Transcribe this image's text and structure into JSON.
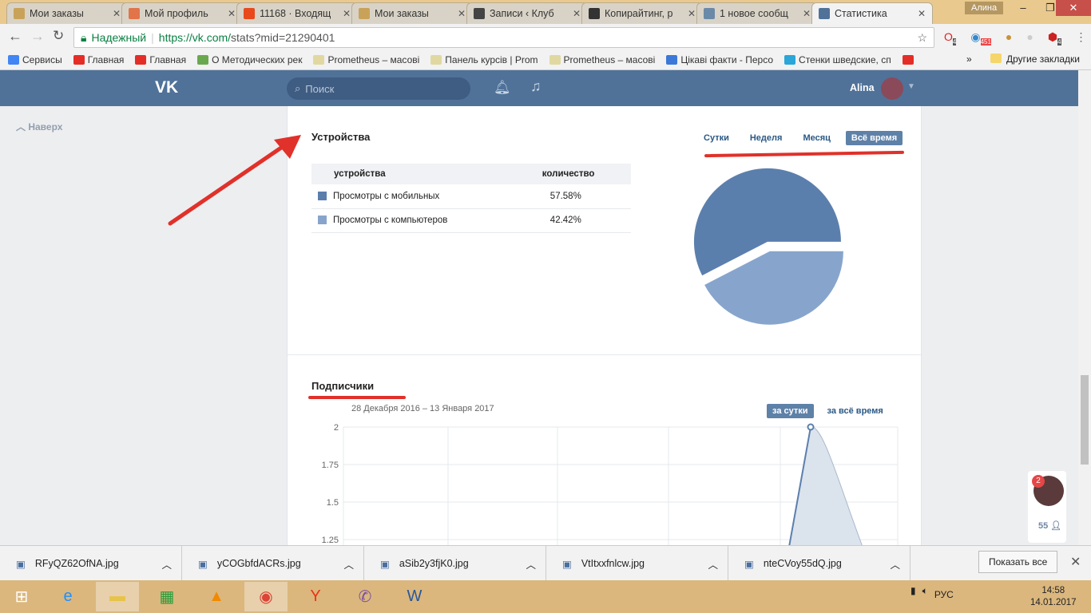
{
  "browser": {
    "tabs": [
      {
        "label": "Мои заказы",
        "icon": "box-icon",
        "color": "#c9a25a"
      },
      {
        "label": "Мой профиль",
        "icon": "olx-icon",
        "color": "#e2744a"
      },
      {
        "label": "11168 · Входящ",
        "icon": "mail-icon",
        "color": "#e84a1c"
      },
      {
        "label": "Мои заказы",
        "icon": "box-icon",
        "color": "#c9a25a"
      },
      {
        "label": "Записи ‹ Клуб",
        "icon": "s-icon",
        "color": "#444444"
      },
      {
        "label": "Копирайтинг, р",
        "icon": "a-icon",
        "color": "#333333"
      },
      {
        "label": "1 новое сообщ",
        "icon": "message-icon",
        "color": "#6b8aa8"
      },
      {
        "label": "Статистика",
        "icon": "vk-icon",
        "color": "#507299",
        "active": true
      }
    ],
    "user": "Алина",
    "security": "Надежный",
    "url_host": "https://vk.com/",
    "url_path": "stats?mid=21290401",
    "extension_badges": [
      "4",
      "451",
      "4"
    ],
    "bookmarks": [
      {
        "label": "Сервисы",
        "color": "#4285f4"
      },
      {
        "label": "Главная",
        "color": "#e52d27"
      },
      {
        "label": "Главная",
        "color": "#e52d27"
      },
      {
        "label": "О Методических рек",
        "color": "#6aa84f"
      },
      {
        "label": "Prometheus – масові",
        "color": "#e0d8a0"
      },
      {
        "label": "Панель курсів | Prom",
        "color": "#e0d8a0"
      },
      {
        "label": "Prometheus – масові",
        "color": "#e0d8a0"
      },
      {
        "label": "Цікаві факти - Персо",
        "color": "#3c78d8"
      },
      {
        "label": "Стенки шведские, сп",
        "color": "#2aa6d8"
      }
    ],
    "more": "»",
    "other_bookmarks": "Другие закладки"
  },
  "vk": {
    "search_placeholder": "Поиск",
    "user_name": "Alina",
    "back_to_top": "Наверх",
    "friends_count": "55",
    "chat_badge": "2"
  },
  "devices": {
    "title": "Устройства",
    "periods": [
      "Сутки",
      "Неделя",
      "Месяц",
      "Всё время"
    ],
    "active_period": "Всё время",
    "columns": [
      "устройства",
      "количество"
    ],
    "rows": [
      {
        "label": "Просмотры с мобильных",
        "value": "57.58%",
        "color": "#5b7fad"
      },
      {
        "label": "Просмотры с компьютеров",
        "value": "42.42%",
        "color": "#87a5cc"
      }
    ]
  },
  "subscribers": {
    "title": "Подписчики",
    "date_range": "28 Декабря 2016 – 13 Января 2017",
    "periods": [
      "за сутки",
      "за всё время"
    ],
    "active_period": "за сутки"
  },
  "chart_data": [
    {
      "type": "pie",
      "values": [
        57.58,
        42.42
      ],
      "labels": [
        "Просмотры с мобильных",
        "Просмотры с компьютеров"
      ],
      "colors": [
        "#5b7fad",
        "#87a5cc"
      ]
    },
    {
      "type": "area",
      "yticks": [
        "2",
        "1.75",
        "1.5",
        "1.25"
      ],
      "ylim_visible": [
        1.25,
        2
      ],
      "peak_value": 2,
      "grid": true,
      "color": "#5b7fad"
    }
  ],
  "downloads": {
    "files": [
      "RFyQZ62OfNA.jpg",
      "yCOGbfdACRs.jpg",
      "aSib2y3fjK0.jpg",
      "VtItxxfnlcw.jpg",
      "nteCVoy55dQ.jpg"
    ],
    "show_all": "Показать все"
  },
  "taskbar": {
    "lang": "РУС",
    "time": "14:58",
    "date": "14.01.2017"
  }
}
